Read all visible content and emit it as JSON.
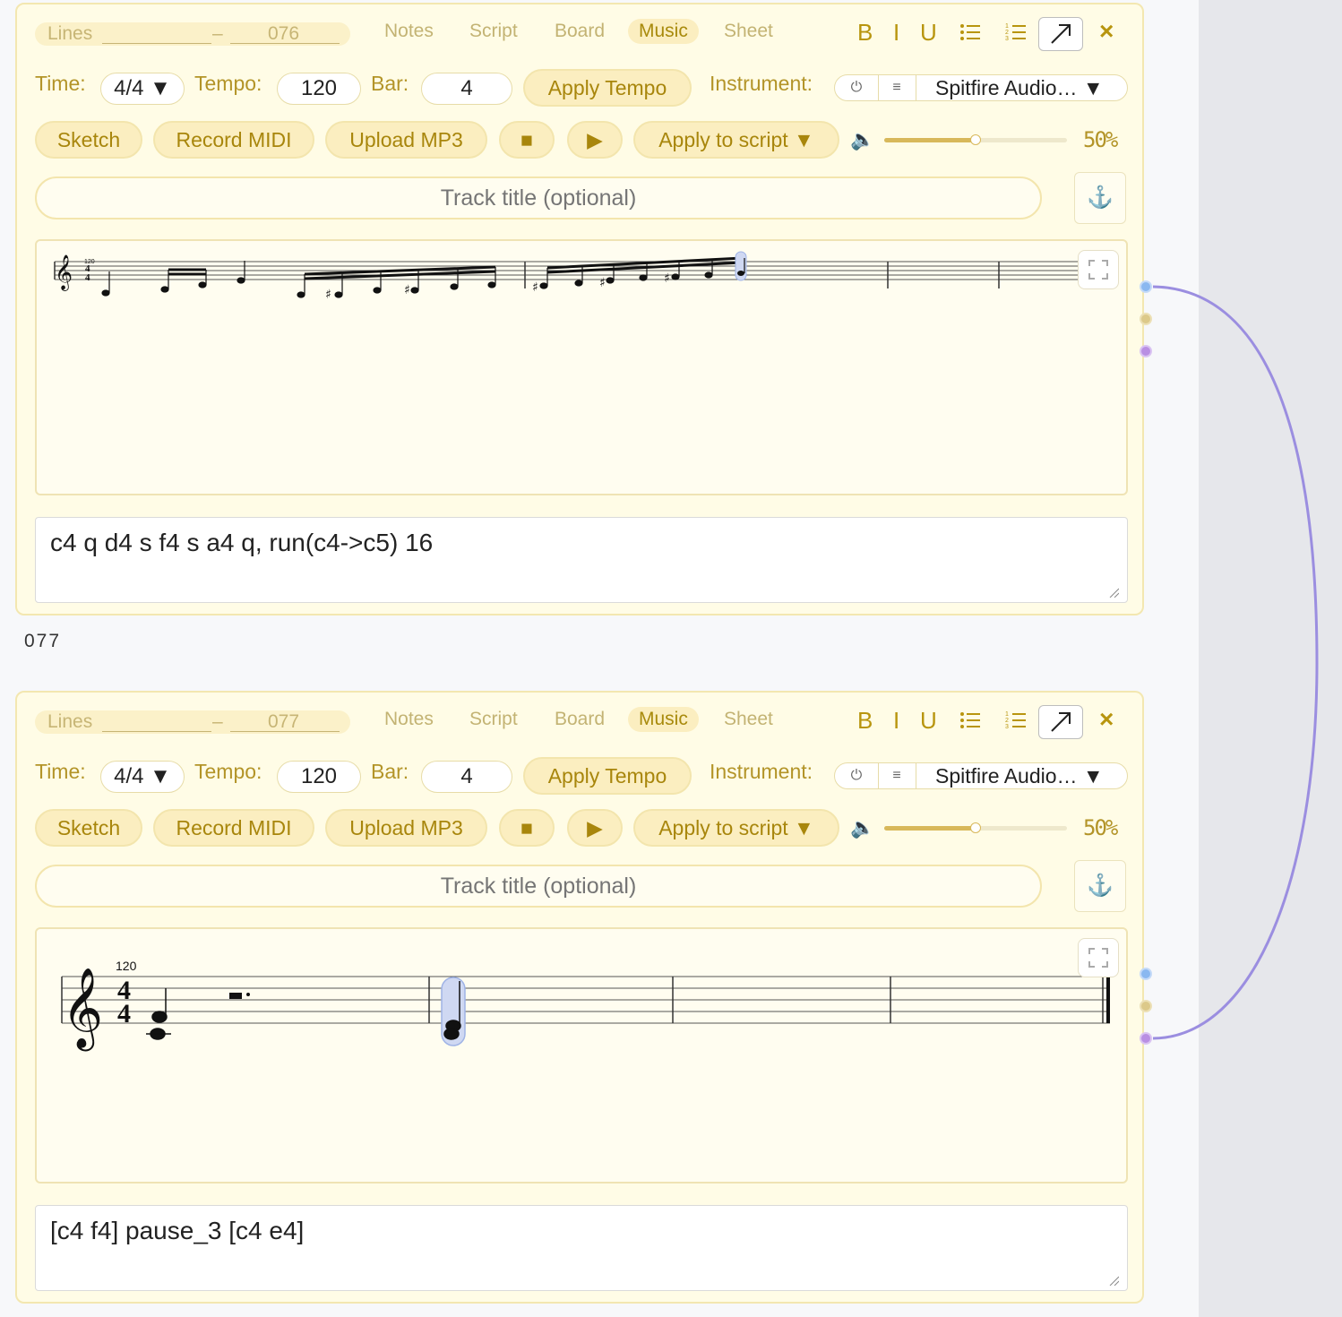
{
  "panels": [
    {
      "lines_label": "Lines",
      "lines_dash": "–",
      "lines_number": "076",
      "tabs": [
        "Notes",
        "Script",
        "Board",
        "Music",
        "Sheet"
      ],
      "active_tab": "Music",
      "format": {
        "bold": "B",
        "italic": "I",
        "underline": "U"
      },
      "close": "×",
      "time_label": "Time:",
      "time_value": "4/4 ▼",
      "tempo_label": "Tempo:",
      "tempo_value": "120",
      "bar_label": "Bar:",
      "bar_value": "4",
      "apply_tempo": "Apply Tempo",
      "instrument_label": "Instrument:",
      "instrument_power": "⏻",
      "instrument_list": "≡",
      "instrument_value": "Spitfire Audio… ▼",
      "buttons": {
        "sketch": "Sketch",
        "record": "Record MIDI",
        "upload": "Upload MP3",
        "stop": "■",
        "play": "▶",
        "apply_script": "Apply to script ▼"
      },
      "volume_icon": "🔈",
      "volume": 50,
      "volume_text": "50%",
      "title_placeholder": "Track title (optional)",
      "anchor": "⚓",
      "score_tempo": "120",
      "script": "c4 q d4 s f4 s a4 q, run(c4->c5) 16"
    },
    {
      "lines_label": "Lines",
      "lines_dash": "–",
      "lines_number": "077",
      "tabs": [
        "Notes",
        "Script",
        "Board",
        "Music",
        "Sheet"
      ],
      "active_tab": "Music",
      "format": {
        "bold": "B",
        "italic": "I",
        "underline": "U"
      },
      "close": "×",
      "time_label": "Time:",
      "time_value": "4/4 ▼",
      "tempo_label": "Tempo:",
      "tempo_value": "120",
      "bar_label": "Bar:",
      "bar_value": "4",
      "apply_tempo": "Apply Tempo",
      "instrument_label": "Instrument:",
      "instrument_power": "⏻",
      "instrument_list": "≡",
      "instrument_value": "Spitfire Audio… ▼",
      "buttons": {
        "sketch": "Sketch",
        "record": "Record MIDI",
        "upload": "Upload MP3",
        "stop": "■",
        "play": "▶",
        "apply_script": "Apply to script ▼"
      },
      "volume_icon": "🔈",
      "volume": 50,
      "volume_text": "50%",
      "title_placeholder": "Track title (optional)",
      "anchor": "⚓",
      "score_tempo": "120",
      "script": "[c4 f4] pause_3 [c4 e4]"
    }
  ],
  "between_label": "077",
  "colors": {
    "accent": "#b8950e",
    "panel_bg": "#fffce6",
    "connector": "#9b8ee0"
  }
}
